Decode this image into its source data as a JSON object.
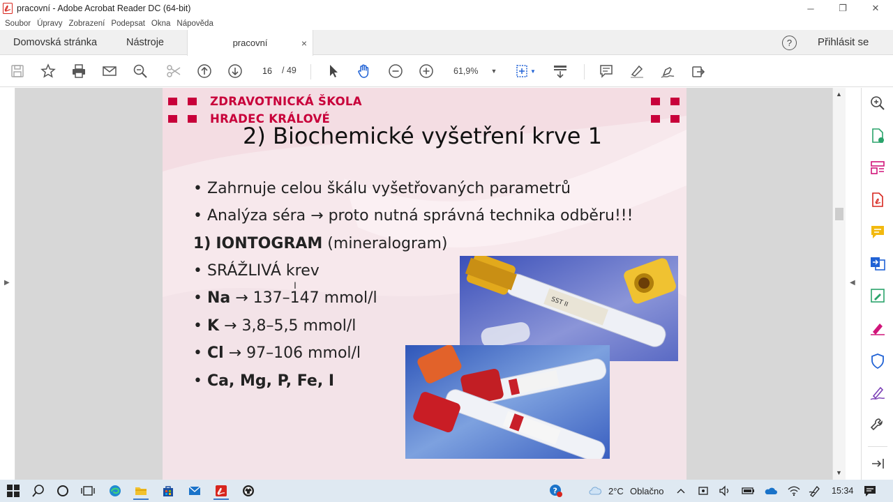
{
  "window": {
    "title": "pracovní - Adobe Acrobat Reader DC (64-bit)"
  },
  "menu": [
    "Soubor",
    "Úpravy",
    "Zobrazení",
    "Podepsat",
    "Okna",
    "Nápověda"
  ],
  "tabs": {
    "home": "Domovská stránka",
    "tools": "Nástroje",
    "document": "pracovní",
    "close": "×"
  },
  "account": {
    "help": "?",
    "sign_in": "Přihlásit se"
  },
  "toolbar": {
    "page_current": "16",
    "page_total": "/ 49",
    "zoom": "61,9%"
  },
  "slide": {
    "school_line1": "ZDRAVOTNICKÁ ŠKOLA",
    "school_line2": "HRADEC KRÁLOVÉ",
    "title": "2) Biochemické vyšetření krve  1",
    "bullet1": "Zahrnuje celou škálu vyšetřovaných parametrů",
    "bullet2": "Analýza séra → proto nutná správná technika odběru!!!",
    "heading_num": "1)",
    "heading_bold": "IONTOGRAM",
    "heading_rest": " (mineralogram)",
    "bullet3": "SRÁŽLIVÁ krev",
    "na_label": "Na",
    "na_value": " → 137–147 mmol/l",
    "k_label": "K",
    "k_value": " → 3,8–5,5 mmol/l",
    "cl_label": "Cl",
    "cl_value": " → 97–106 mmol/l",
    "last": "Ca, Mg, P, Fe, I",
    "tube_label_1": "SST II"
  },
  "taskbar": {
    "weather_temp": "2°C",
    "weather_desc": "Oblačno",
    "time": "15:34"
  },
  "colors": {
    "accent": "#c8003a",
    "acrobat_red": "#d7261e",
    "tool_green": "#2aa36b",
    "tool_pink": "#d1157a",
    "tool_blue": "#2062d5",
    "tool_yellow": "#f2b90f",
    "tool_purple": "#7b3fb6"
  }
}
